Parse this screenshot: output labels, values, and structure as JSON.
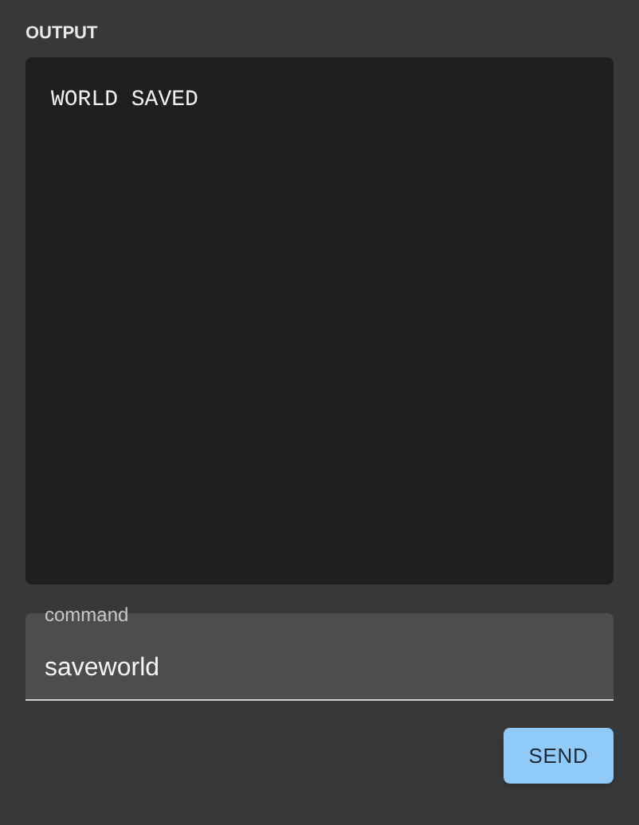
{
  "output": {
    "label": "OUTPUT",
    "text": "WORLD SAVED"
  },
  "command": {
    "label": "command",
    "value": "saveworld"
  },
  "buttons": [
    "SEND"
  ]
}
